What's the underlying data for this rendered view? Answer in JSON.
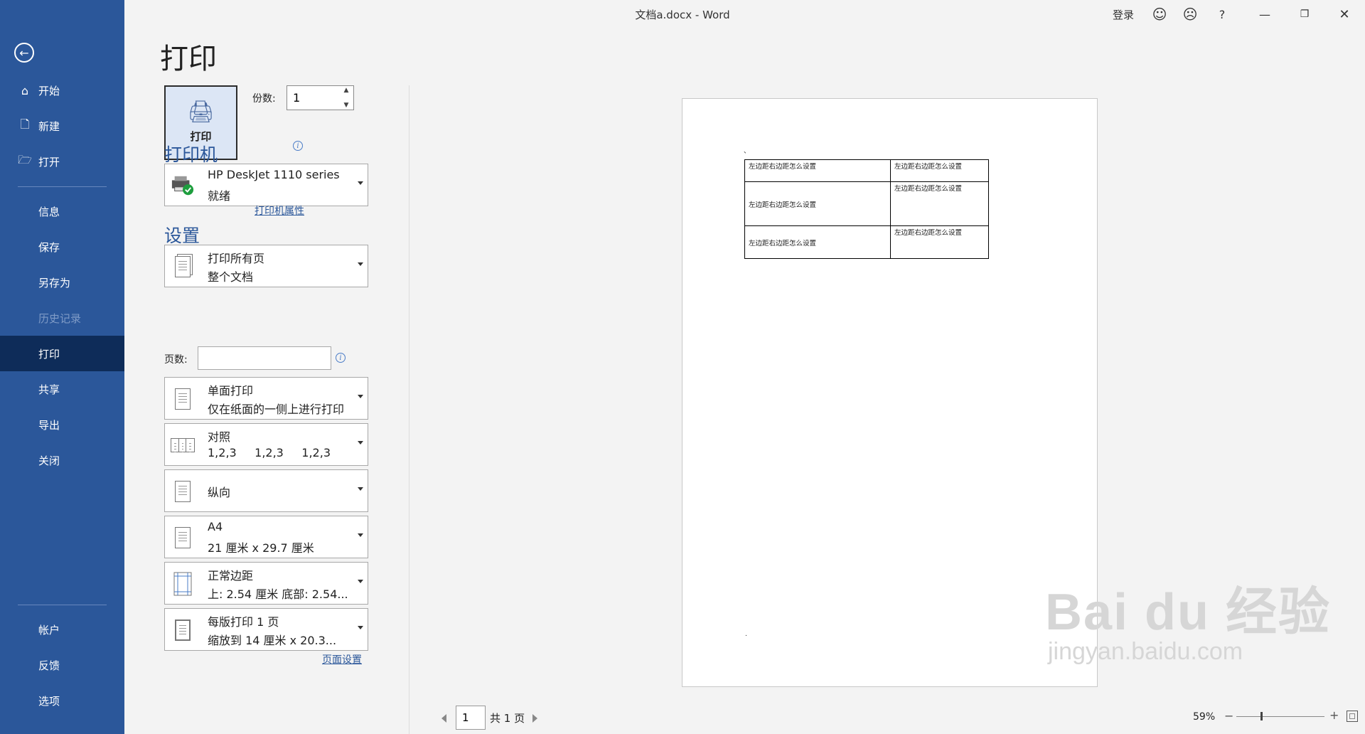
{
  "window": {
    "title": "文档a.docx  -  Word",
    "login": "登录",
    "help": "?"
  },
  "sidebar": {
    "items": [
      {
        "label": "开始",
        "icon": "home-icon"
      },
      {
        "label": "新建",
        "icon": "new-document-icon"
      },
      {
        "label": "打开",
        "icon": "open-folder-icon"
      },
      {
        "label": "信息"
      },
      {
        "label": "保存"
      },
      {
        "label": "另存为"
      },
      {
        "label": "历史记录"
      },
      {
        "label": "打印"
      },
      {
        "label": "共享"
      },
      {
        "label": "导出"
      },
      {
        "label": "关闭"
      },
      {
        "label": "帐户"
      },
      {
        "label": "反馈"
      },
      {
        "label": "选项"
      }
    ]
  },
  "print": {
    "page_title": "打印",
    "print_button": "打印",
    "copies_label": "份数:",
    "copies_value": "1",
    "printer_section": "打印机",
    "printer_name": "HP DeskJet 1110 series",
    "printer_status": "就绪",
    "printer_properties_link": "打印机属性",
    "settings_section": "设置",
    "pages_label": "页数:",
    "pages_value": "",
    "page_setup_link": "页面设置",
    "settings": [
      {
        "line1": "打印所有页",
        "line2": "整个文档"
      },
      {
        "line1": "单面打印",
        "line2": "仅在纸面的一侧上进行打印"
      },
      {
        "line1": "对照",
        "line2": "1,2,3     1,2,3     1,2,3"
      },
      {
        "line1": "纵向"
      },
      {
        "line1": "A4",
        "line2": "21 厘米 x 29.7 厘米"
      },
      {
        "line1": "正常边距",
        "line2": "上: 2.54 厘米 底部: 2.54..."
      },
      {
        "line1": "每版打印 1 页",
        "line2": "缩放到 14 厘米 x 20.3..."
      }
    ]
  },
  "preview": {
    "table": [
      [
        "左边距右边距怎么设置",
        "左边距右边距怎么设置"
      ],
      [
        "左边距右边距怎么设置",
        "左边距右边距怎么设置"
      ],
      [
        "左边距右边距怎么设置",
        "左边距右边距怎么设置"
      ]
    ],
    "top_mark": "、",
    "bottom_mark": "."
  },
  "statusbar": {
    "page_current": "1",
    "page_total": "共 1 页",
    "zoom": "59%",
    "zoom_minus": "−",
    "zoom_plus": "+",
    "zoom_level": 0.59
  },
  "watermark": {
    "logo": "Bai du 经验",
    "url": "jingyan.baidu.com"
  },
  "colors": {
    "sidebar": "#2b579a",
    "sidebar_active": "#0e2c59",
    "accent": "#2b579a"
  }
}
